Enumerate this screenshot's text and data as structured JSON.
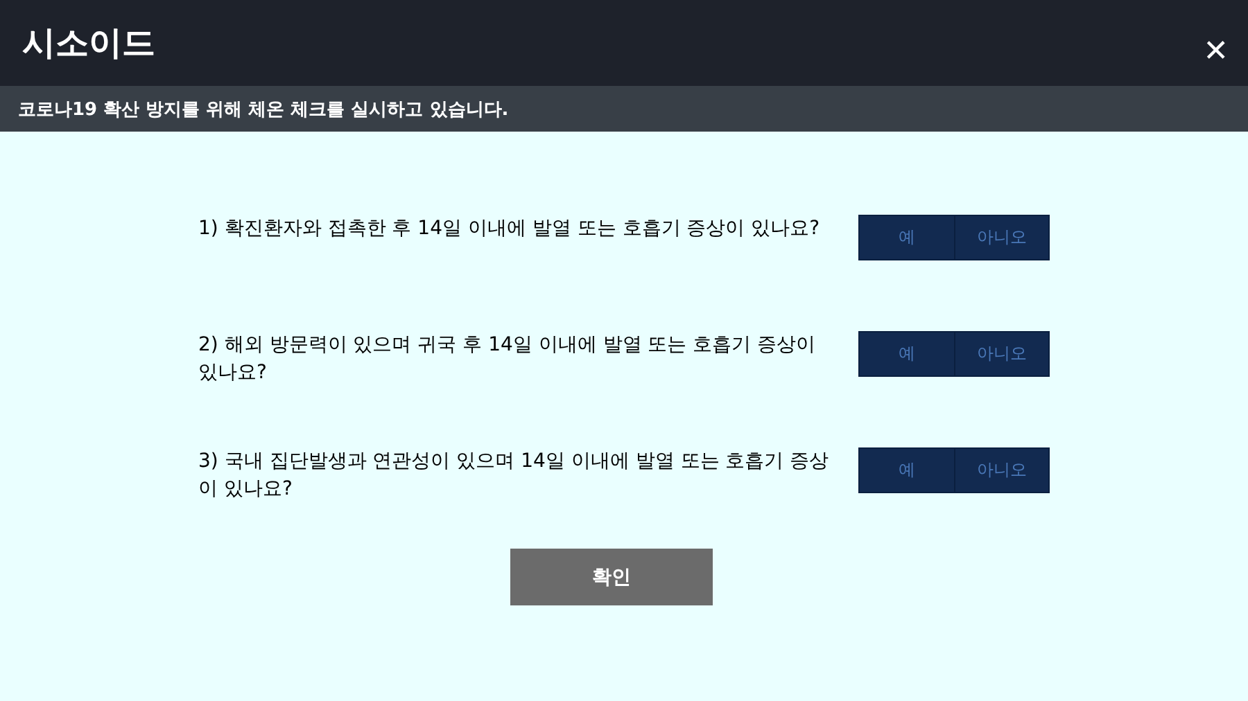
{
  "window": {
    "title": "시소이드",
    "close": "✕"
  },
  "notice": "코로나19 확산 방지를 위해 체온 체크를 실시하고 있습니다.",
  "questions": [
    {
      "text": "1) 확진환자와 접촉한 후 14일 이내에 발열 또는 호흡기 증상이 있나요?",
      "yes": "예",
      "no": "아니오"
    },
    {
      "text": "2) 해외 방문력이 있으며 귀국 후 14일 이내에 발열 또는 호흡기 증상이 있나요?",
      "yes": "예",
      "no": "아니오"
    },
    {
      "text": "3) 국내 집단발생과 연관성이 있으며 14일 이내에 발열 또는 호흡기 증상이 있나요?",
      "yes": "예",
      "no": "아니오"
    }
  ],
  "confirm_button": "확인"
}
